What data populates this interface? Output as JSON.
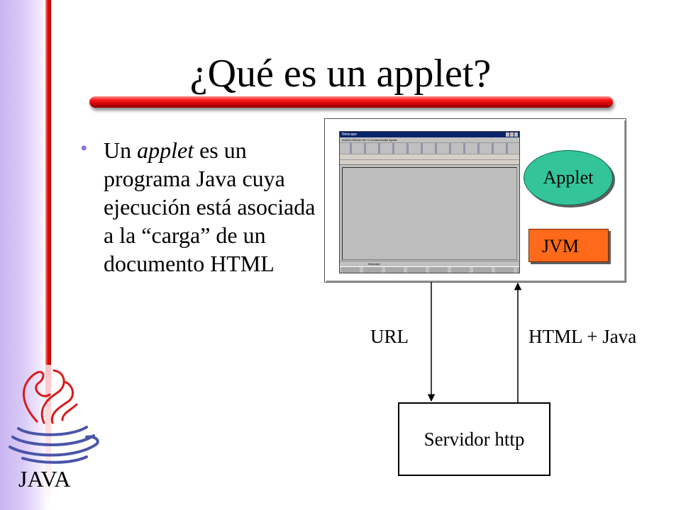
{
  "slide": {
    "title": "¿Qué es un applet?",
    "bullet": {
      "before": "Un ",
      "emphasis": "applet",
      "after": " es un programa Java cuya ejecución está asociada a la “carga” de un documento HTML"
    }
  },
  "diagram": {
    "browser": {
      "window_title": "Netscape",
      "menu": "Archivo  Edición  Ver  Ir  Communicator  Ayuda",
      "status": "Netscape"
    },
    "applet_label": "Applet",
    "jvm_label": "JVM",
    "request_label": "URL",
    "response_label": "HTML + Java",
    "server_label": "Servidor http"
  },
  "logo": {
    "text": "JAVA"
  },
  "colors": {
    "title_bar": "#e00000",
    "applet_fill": "#33c49a",
    "jvm_fill": "#ff6a1a",
    "bullet": "#8a76e0",
    "left_band": "#c9b6f2",
    "logo_red": "#d81b1b",
    "logo_blue": "#4a55a8"
  }
}
